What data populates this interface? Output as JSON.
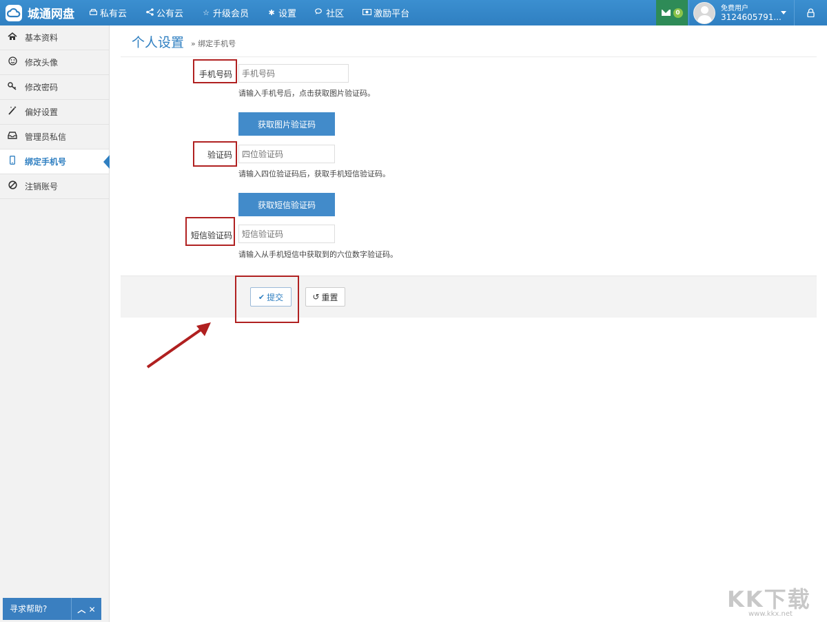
{
  "navbar": {
    "brand": "城通网盘",
    "items": [
      {
        "label": "私有云",
        "icon": "drive-icon"
      },
      {
        "label": "公有云",
        "icon": "share-icon"
      },
      {
        "label": "升级会员",
        "icon": "star-icon"
      },
      {
        "label": "设置",
        "icon": "gear-icon"
      },
      {
        "label": "社区",
        "icon": "comments-icon"
      },
      {
        "label": "激励平台",
        "icon": "money-icon"
      }
    ],
    "mail_count": "0",
    "user_type": "免费用户",
    "user_id": "3124605791..."
  },
  "sidebar": {
    "items": [
      {
        "label": "基本资料",
        "icon": "home-icon",
        "active": false
      },
      {
        "label": "修改头像",
        "icon": "smile-icon",
        "active": false
      },
      {
        "label": "修改密码",
        "icon": "key-icon",
        "active": false
      },
      {
        "label": "偏好设置",
        "icon": "magic-icon",
        "active": false
      },
      {
        "label": "管理员私信",
        "icon": "inbox-icon",
        "active": false
      },
      {
        "label": "绑定手机号",
        "icon": "mobile-icon",
        "active": true
      },
      {
        "label": "注销账号",
        "icon": "ban-icon",
        "active": false
      }
    ],
    "help_label": "寻求帮助?"
  },
  "main": {
    "title": "个人设置",
    "breadcrumb": "» 绑定手机号",
    "phone": {
      "label": "手机号码",
      "placeholder": "手机号码",
      "help": "请输入手机号后，点击获取图片验证码。"
    },
    "get_image_code_button": "获取图片验证码",
    "captcha": {
      "label": "验证码",
      "placeholder": "四位验证码",
      "help": "请输入四位验证码后，获取手机短信验证码。"
    },
    "get_sms_code_button": "获取短信验证码",
    "sms": {
      "label": "短信验证码",
      "placeholder": "短信验证码",
      "help": "请输入从手机短信中获取到的六位数字验证码。"
    },
    "submit_label": "提交",
    "reset_label": "重置"
  },
  "watermark": {
    "text": "KK下载",
    "url": "www.kkx.net"
  },
  "colors": {
    "nav_bg": "#2f7fc1",
    "primary_button": "#428bca",
    "annotation_red": "#b02020",
    "mail_bg": "#2e8b57"
  }
}
